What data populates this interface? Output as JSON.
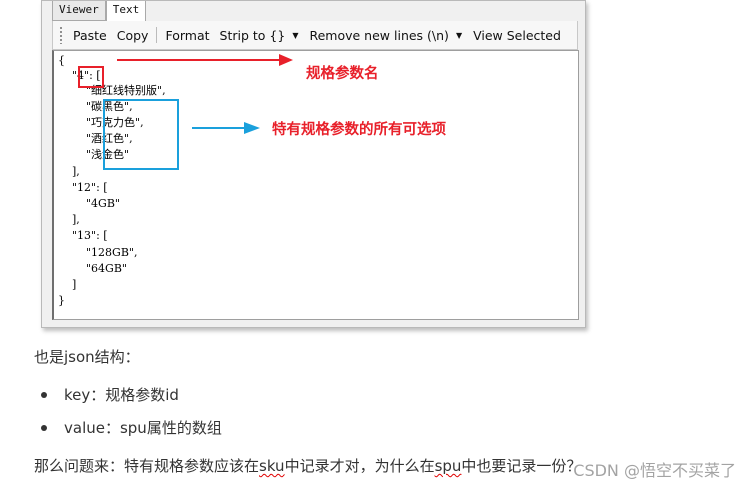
{
  "viewer": {
    "tabs": [
      {
        "label": "Viewer",
        "active": false
      },
      {
        "label": "Text",
        "active": true
      }
    ],
    "toolbar": {
      "paste": "Paste",
      "copy": "Copy",
      "format": "Format",
      "strip": "Strip to {}",
      "remove_newlines": "Remove new lines (\\n)",
      "view_selected": "View Selected"
    },
    "json_lines": [
      "{",
      "    \"4\": [",
      "        \"细红线特别版\",",
      "        \"碳黑色\",",
      "        \"巧克力色\",",
      "        \"酒红色\",",
      "        \"浅金色\"",
      "    ],",
      "    \"12\": [",
      "        \"4GB\"",
      "    ],",
      "    \"13\": [",
      "        \"128GB\",",
      "        \"64GB\"",
      "    ]",
      "}"
    ]
  },
  "annotations": {
    "key_label": "规格参数名",
    "options_label": "特有规格参数的所有可选项",
    "colors": {
      "red": "#e8202a",
      "blue": "#1aa0dc"
    }
  },
  "article": {
    "intro": "也是json结构：",
    "bullets": [
      "key：规格参数id",
      "value：spu属性的数组"
    ],
    "question_prefix": "那么问题来：特有规格参数应该在",
    "question_sku": "sku",
    "question_mid": "中记录才对，为什么在",
    "question_spu": "spu",
    "question_suffix": "中也要记录一份？"
  },
  "watermark": "CSDN @悟空不买菜了"
}
